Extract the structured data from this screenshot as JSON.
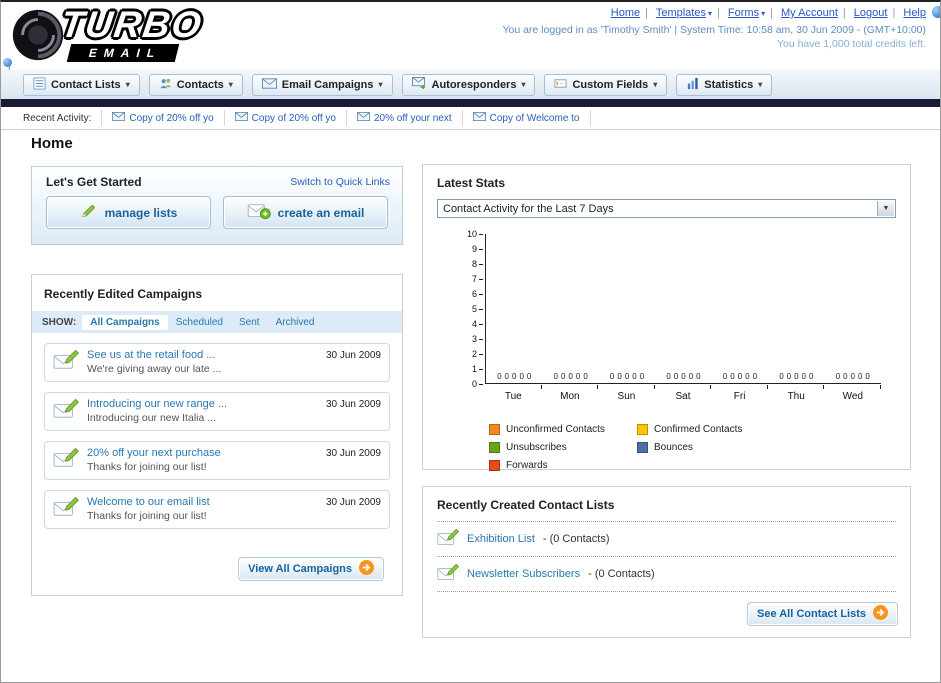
{
  "page_title": "Home",
  "header": {
    "logo_brand": "TURBO",
    "logo_sub": "EMAIL",
    "top_links": [
      "Home",
      "Templates",
      "Forms",
      "My Account",
      "Logout",
      "Help"
    ],
    "login_info": "You are logged in as 'Timothy Smith' | System Time: 10:58 am, 30 Jun 2009 - (GMT+10:00)",
    "credits_info": "You have 1,000 total credits left."
  },
  "nav": {
    "items": [
      {
        "label": "Contact Lists"
      },
      {
        "label": "Contacts"
      },
      {
        "label": "Email Campaigns"
      },
      {
        "label": "Autoresponders"
      },
      {
        "label": "Custom Fields"
      },
      {
        "label": "Statistics"
      }
    ]
  },
  "recent_activity": {
    "label": "Recent Activity:",
    "items": [
      "Copy of 20% off yo",
      "Copy of 20% off yo",
      "20% off your next",
      "Copy of Welcome to"
    ]
  },
  "get_started": {
    "title": "Let's Get Started",
    "switch_link": "Switch to Quick Links",
    "manage_lists_label": "manage lists",
    "create_email_label": "create an email"
  },
  "campaigns": {
    "title": "Recently Edited Campaigns",
    "show_label": "SHOW:",
    "tabs": [
      "All Campaigns",
      "Scheduled",
      "Sent",
      "Archived"
    ],
    "active_tab": "All Campaigns",
    "items": [
      {
        "title": "See us at the retail food ...",
        "subtitle": "We're giving away our late ...",
        "date": "30 Jun 2009"
      },
      {
        "title": "Introducing our new range ...",
        "subtitle": "Introducing our new Italia ...",
        "date": "30 Jun 2009"
      },
      {
        "title": "20% off your next purchase",
        "subtitle": "Thanks for joining our list!",
        "date": "30 Jun 2009"
      },
      {
        "title": "Welcome to our email list",
        "subtitle": "Thanks for joining our list!",
        "date": "30 Jun 2009"
      }
    ],
    "view_all_label": "View All Campaigns"
  },
  "stats": {
    "title": "Latest Stats",
    "period_selector": "Contact Activity for the Last 7 Days",
    "chart_data": {
      "type": "bar",
      "title": "Contact Activity for the Last 7 Days",
      "categories": [
        "Tue",
        "Mon",
        "Sun",
        "Sat",
        "Fri",
        "Thu",
        "Wed"
      ],
      "series": [
        {
          "name": "Unconfirmed Contacts",
          "color": "#f28a1e",
          "values": [
            0,
            0,
            0,
            0,
            0,
            0,
            0
          ]
        },
        {
          "name": "Confirmed Contacts",
          "color": "#fdc400",
          "values": [
            0,
            0,
            0,
            0,
            0,
            0,
            0
          ]
        },
        {
          "name": "Unsubscribes",
          "color": "#69a317",
          "values": [
            0,
            0,
            0,
            0,
            0,
            0,
            0
          ]
        },
        {
          "name": "Bounces",
          "color": "#4d6fa0",
          "values": [
            0,
            0,
            0,
            0,
            0,
            0,
            0
          ]
        },
        {
          "name": "Forwards",
          "color": "#e8491d",
          "values": [
            0,
            0,
            0,
            0,
            0,
            0,
            0
          ]
        }
      ],
      "ylim": [
        0,
        10
      ],
      "yticks": [
        0,
        1,
        2,
        3,
        4,
        5,
        6,
        7,
        8,
        9,
        10
      ],
      "legend_position": "bottom",
      "grid": false
    }
  },
  "contact_lists": {
    "title": "Recently Created Contact Lists",
    "items": [
      {
        "name": "Exhibition List",
        "suffix": " - (0 Contacts)"
      },
      {
        "name": "Newsletter Subscribers",
        "suffix": " - (0 Contacts)"
      }
    ],
    "see_all_label": "See All Contact Lists"
  }
}
